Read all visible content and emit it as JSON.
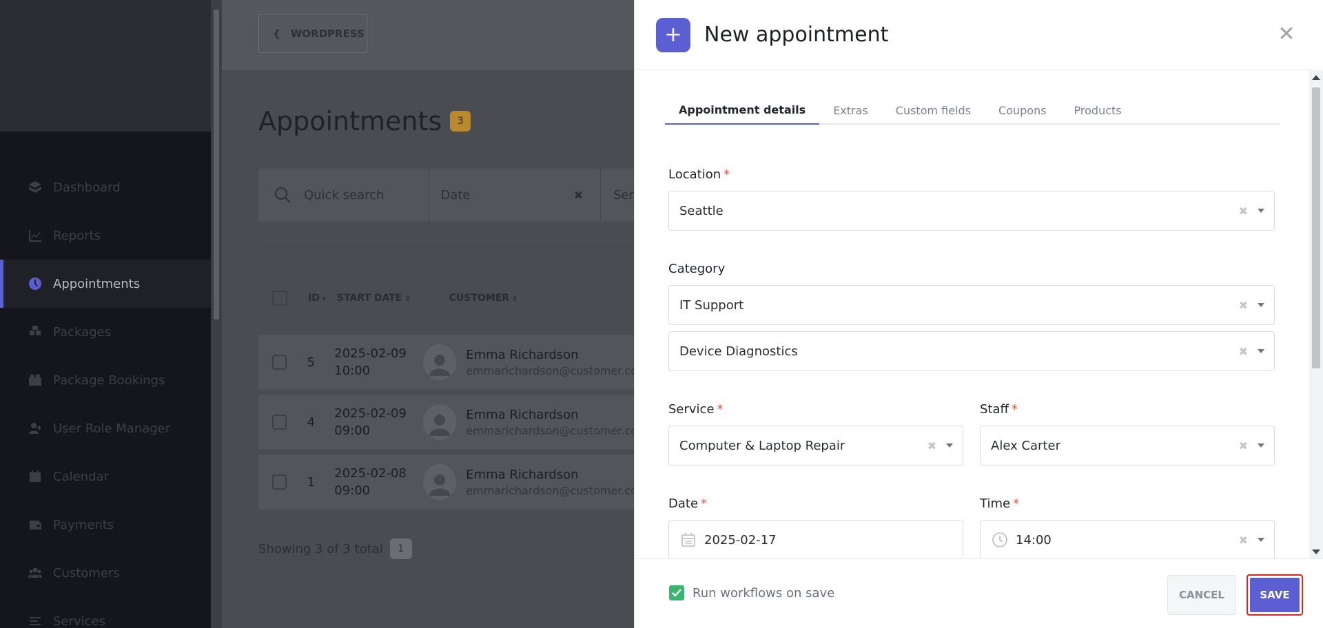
{
  "sidebar": {
    "items": [
      {
        "label": "Dashboard",
        "icon": "dashboard-icon"
      },
      {
        "label": "Reports",
        "icon": "chart-icon"
      },
      {
        "label": "Appointments",
        "icon": "clock-icon",
        "active": true
      },
      {
        "label": "Packages",
        "icon": "packages-icon"
      },
      {
        "label": "Package Bookings",
        "icon": "package-bookings-icon"
      },
      {
        "label": "User Role Manager",
        "icon": "user-plus-icon"
      },
      {
        "label": "Calendar",
        "icon": "calendar-icon"
      },
      {
        "label": "Payments",
        "icon": "wallet-icon"
      },
      {
        "label": "Customers",
        "icon": "users-icon"
      },
      {
        "label": "Services",
        "icon": "list-icon"
      }
    ]
  },
  "main": {
    "back_label": "WORDPRESS",
    "title": "Appointments",
    "count": "3",
    "filters": {
      "search_placeholder": "Quick search",
      "date_placeholder": "Date",
      "service_placeholder": "Ser"
    },
    "columns": {
      "id": "ID",
      "start": "START DATE",
      "customer": "CUSTOMER"
    },
    "rows": [
      {
        "id": "5",
        "date": "2025-02-09",
        "time": "10:00",
        "name": "Emma Richardson",
        "email": "emmarichardson@customer.com"
      },
      {
        "id": "4",
        "date": "2025-02-09",
        "time": "09:00",
        "name": "Emma Richardson",
        "email": "emmarichardson@customer.com"
      },
      {
        "id": "1",
        "date": "2025-02-08",
        "time": "09:00",
        "name": "Emma Richardson",
        "email": "emmarichardson@customer.com"
      }
    ],
    "showing": "Showing 3 of 3 total",
    "page": "1"
  },
  "panel": {
    "title": "New appointment",
    "tabs": [
      "Appointment details",
      "Extras",
      "Custom fields",
      "Coupons",
      "Products"
    ],
    "active_tab": "Appointment details",
    "location": {
      "label": "Location",
      "value": "Seattle"
    },
    "category": {
      "label": "Category",
      "value": "IT Support",
      "sub_value": "Device Diagnostics"
    },
    "service": {
      "label": "Service",
      "value": "Computer & Laptop Repair"
    },
    "staff": {
      "label": "Staff",
      "value": "Alex Carter"
    },
    "date": {
      "label": "Date",
      "value": "2025-02-17"
    },
    "time": {
      "label": "Time",
      "value": "14:00"
    },
    "required_mark": "*",
    "footer": {
      "workflows_label": "Run workflows on save",
      "workflows_checked": true,
      "cancel_label": "CANCEL",
      "save_label": "SAVE"
    }
  },
  "colors": {
    "accent": "#5b5fd1",
    "badge": "#e8a53b",
    "check": "#3cb371",
    "required": "#e5533d",
    "highlight": "#e02424"
  }
}
